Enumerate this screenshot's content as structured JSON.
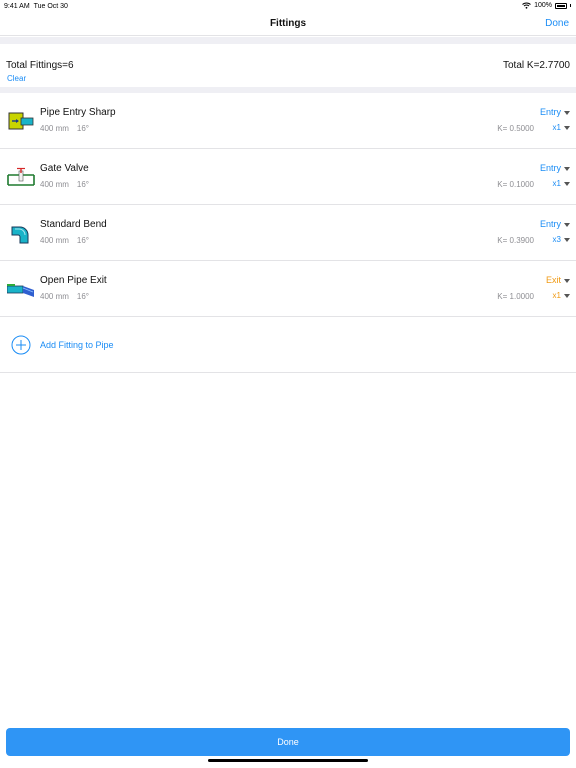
{
  "status_bar": {
    "time": "9:41 AM",
    "date": "Tue Oct 30",
    "battery": "100%"
  },
  "nav": {
    "title": "Fittings",
    "done_label": "Done"
  },
  "summary": {
    "total_fittings": "Total Fittings=6",
    "total_k": "Total K=2.7700",
    "clear_label": "Clear"
  },
  "fittings": [
    {
      "name": "Pipe Entry Sharp",
      "size": "400 mm",
      "angle": "16°",
      "k": "K= 0.5000",
      "type": "Entry",
      "qty": "x1",
      "icon": "pipe-entry-sharp-icon"
    },
    {
      "name": "Gate Valve",
      "size": "400 mm",
      "angle": "16°",
      "k": "K= 0.1000",
      "type": "Entry",
      "qty": "x1",
      "icon": "gate-valve-icon"
    },
    {
      "name": "Standard Bend",
      "size": "400 mm",
      "angle": "16°",
      "k": "K= 0.3900",
      "type": "Entry",
      "qty": "x3",
      "icon": "standard-bend-icon"
    },
    {
      "name": "Open Pipe Exit",
      "size": "400 mm",
      "angle": "16°",
      "k": "K= 1.0000",
      "type": "Exit",
      "qty": "x1",
      "icon": "open-pipe-exit-icon"
    }
  ],
  "add_fitting": {
    "label": "Add Fitting to Pipe"
  },
  "footer": {
    "done_label": "Done"
  },
  "colors": {
    "accent": "#1a8cf5",
    "exit": "#f09a14",
    "button": "#2f95f5",
    "separator": "#efeff4"
  }
}
